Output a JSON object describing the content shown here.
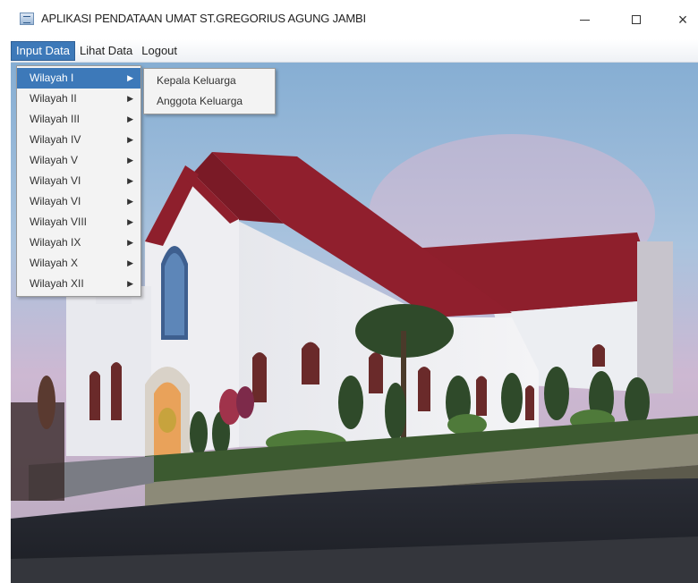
{
  "window": {
    "title": "APLIKASI PENDATAAN UMAT ST.GREGORIUS AGUNG JAMBI",
    "minimize_label": "",
    "close_label": "×"
  },
  "menubar": {
    "items": [
      {
        "label": "Input Data",
        "active": true
      },
      {
        "label": "Lihat Data",
        "active": false
      },
      {
        "label": "Logout",
        "active": false
      }
    ]
  },
  "dropdown": {
    "items": [
      {
        "label": "Wilayah I",
        "selected": true
      },
      {
        "label": "Wilayah II"
      },
      {
        "label": "Wilayah III"
      },
      {
        "label": "Wilayah IV"
      },
      {
        "label": "Wilayah V"
      },
      {
        "label": "Wilayah VI"
      },
      {
        "label": "Wilayah VI"
      },
      {
        "label": "Wilayah VIII"
      },
      {
        "label": "Wilayah IX"
      },
      {
        "label": "Wilayah X"
      },
      {
        "label": "Wilayah XII"
      }
    ],
    "arrow_glyph": "▶"
  },
  "submenu": {
    "items": [
      {
        "label": "Kepala Keluarga"
      },
      {
        "label": "Anggota Keluarga"
      }
    ]
  },
  "colors": {
    "menu_highlight": "#3d79b9",
    "roof": "#8e1f2c",
    "church_wall": "#f2f2f4"
  }
}
